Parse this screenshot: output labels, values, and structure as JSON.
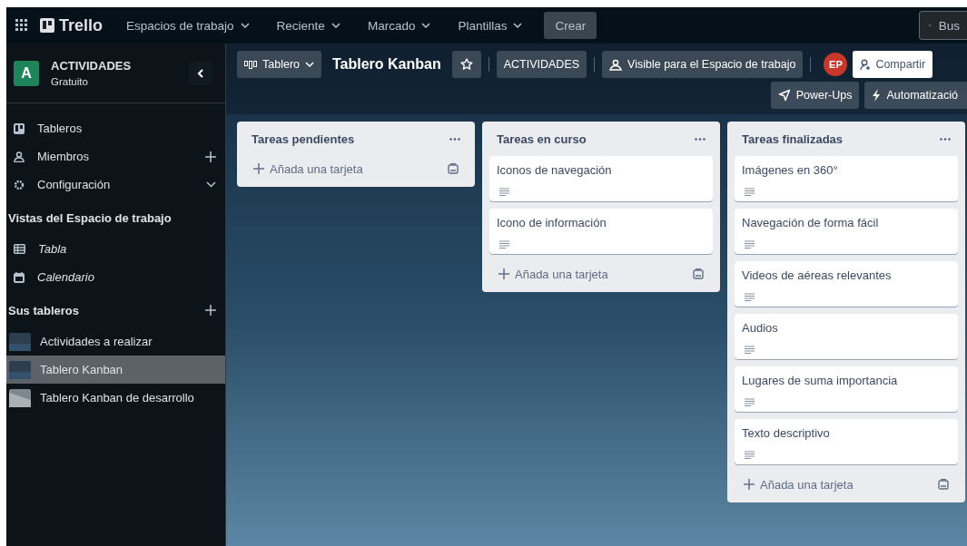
{
  "topbar": {
    "logo": "Trello",
    "menus": [
      "Espacios de trabajo",
      "Reciente",
      "Marcado",
      "Plantillas"
    ],
    "create": "Crear",
    "search": {
      "placeholder": "Bus"
    }
  },
  "sidebar": {
    "workspace": {
      "initial": "A",
      "name": "ACTIVIDADES",
      "plan": "Gratuito"
    },
    "nav": [
      {
        "label": "Tableros",
        "kind": "plain"
      },
      {
        "label": "Miembros",
        "kind": "add"
      },
      {
        "label": "Configuración",
        "kind": "expand"
      }
    ],
    "views_heading": "Vistas del Espacio de trabajo",
    "views": [
      {
        "label": "Tabla"
      },
      {
        "label": "Calendario"
      }
    ],
    "boards_heading": "Sus tableros",
    "boards": [
      {
        "label": "Actividades a realizar",
        "selected": false
      },
      {
        "label": "Tablero Kanban",
        "selected": true
      },
      {
        "label": "Tablero Kanban de desarrollo",
        "selected": false
      }
    ]
  },
  "header": {
    "view": "Tablero",
    "title": "Tablero Kanban",
    "workspace": "ACTIVIDADES",
    "visibility": "Visible para el Espacio de trabajo",
    "avatar": "EP",
    "share": "Compartir",
    "power_ups": "Power-Ups",
    "automation": "Automatizació"
  },
  "lists": [
    {
      "title": "Tareas pendientes",
      "add": "Añada una tarjeta"
    },
    {
      "title": "Tareas en curso",
      "cards": [
        {
          "title": "Iconos de navegación",
          "has_description": true
        },
        {
          "title": "Icono de información",
          "has_description": true
        }
      ],
      "add": "Añada una tarjeta"
    },
    {
      "title": "Tareas finalizadas",
      "cards": [
        {
          "title": "Imágenes en 360°",
          "has_description": true
        },
        {
          "title": "Navegación de forma fácil",
          "has_description": true
        },
        {
          "title": "Videos de aéreas relevantes",
          "has_description": true
        },
        {
          "title": "Audios",
          "has_description": true
        },
        {
          "title": "Lugares de suma importancia",
          "has_description": true
        },
        {
          "title": "Texto descriptivo",
          "has_description": true
        }
      ],
      "add": "Añada una tarjeta"
    }
  ]
}
